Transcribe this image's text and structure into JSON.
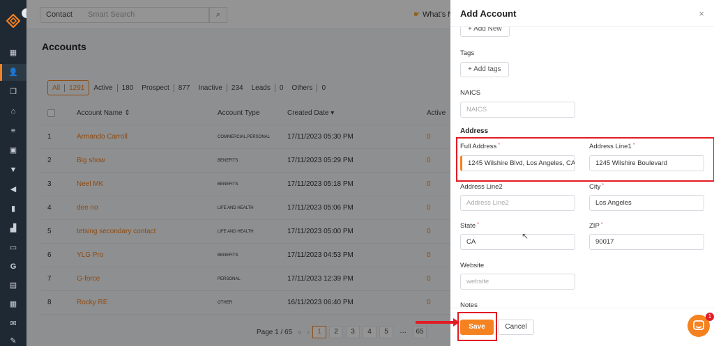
{
  "rail": {
    "icons": [
      "logo-icon",
      "dashboard-icon",
      "contacts-icon",
      "documents-icon",
      "bank-icon",
      "list-icon",
      "id-card-icon",
      "filter-icon",
      "megaphone-icon",
      "book-icon",
      "chart-icon",
      "folder-icon",
      "google-icon",
      "invoice-icon",
      "calendar-icon",
      "mail-icon",
      "signature-icon"
    ]
  },
  "topbar": {
    "contact_type": "Contact",
    "search_placeholder": "Smart Search",
    "whats_new": "What's N"
  },
  "page": {
    "title": "Accounts",
    "filters": [
      {
        "label": "All",
        "count": "1291",
        "selected": true
      },
      {
        "label": "Active",
        "count": "180"
      },
      {
        "label": "Prospect",
        "count": "877"
      },
      {
        "label": "Inactive",
        "count": "234"
      },
      {
        "label": "Leads",
        "count": "0"
      },
      {
        "label": "Others",
        "count": "0"
      }
    ]
  },
  "table": {
    "columns": [
      "Account Name",
      "Account Type",
      "Created Date",
      "Active"
    ],
    "sort_asc": "⇕",
    "sort_desc": "▾",
    "rows": [
      {
        "num": "1",
        "name": "Armando Carroll",
        "type": "Commercial,personal",
        "date": "17/11/2023 05:30 PM",
        "active": "0"
      },
      {
        "num": "2",
        "name": "Big show",
        "type": "BENEFITS",
        "date": "17/11/2023 05:29 PM",
        "active": "0"
      },
      {
        "num": "3",
        "name": "Neel MK",
        "type": "BENEFITS",
        "date": "17/11/2023 05:18 PM",
        "active": "0"
      },
      {
        "num": "4",
        "name": "dee no",
        "type": "LIFE AND HEALTH",
        "date": "17/11/2023 05:06 PM",
        "active": "0"
      },
      {
        "num": "5",
        "name": "tetsing secondary contact",
        "type": "LIFE AND HEALTH",
        "date": "17/11/2023 05:00 PM",
        "active": "0"
      },
      {
        "num": "6",
        "name": "YLG Pro",
        "type": "BENEFITS",
        "date": "17/11/2023 04:53 PM",
        "active": "0"
      },
      {
        "num": "7",
        "name": "G-force",
        "type": "PERSONAL",
        "date": "17/11/2023 12:39 PM",
        "active": "0"
      },
      {
        "num": "8",
        "name": "Rocky RE",
        "type": "OTHER",
        "date": "16/11/2023 06:40 PM",
        "active": "0"
      }
    ]
  },
  "pager": {
    "label": "Page 1 / 65",
    "first": "«",
    "prev": "‹",
    "pages": [
      "1",
      "2",
      "3",
      "4",
      "5",
      "…",
      "65"
    ]
  },
  "modal": {
    "title": "Add Account",
    "close": "×",
    "add_new": "+ Add New",
    "tags_label": "Tags",
    "add_tags": "+ Add tags",
    "naics_label": "NAICS",
    "naics_placeholder": "NAICS",
    "address_section": "Address",
    "full_address_label": "Full Address",
    "full_address_value": "1245 Wilshire Blvd, Los Angeles, CA",
    "address1_label": "Address Line1",
    "address1_value": "1245 Wilshire Boulevard",
    "address2_label": "Address Line2",
    "address2_placeholder": "Address Line2",
    "city_label": "City",
    "city_value": "Los Angeles",
    "state_label": "State",
    "state_value": "CA",
    "zip_label": "ZIP",
    "zip_value": "90017",
    "website_label": "Website",
    "website_placeholder": "website",
    "notes_label": "Notes",
    "required_mark": "*",
    "save": "Save",
    "cancel": "Cancel"
  },
  "chat": {
    "badge": "1"
  },
  "colors": {
    "accent": "#f58220",
    "highlight": "#e31b23",
    "rail": "#1f2933"
  }
}
